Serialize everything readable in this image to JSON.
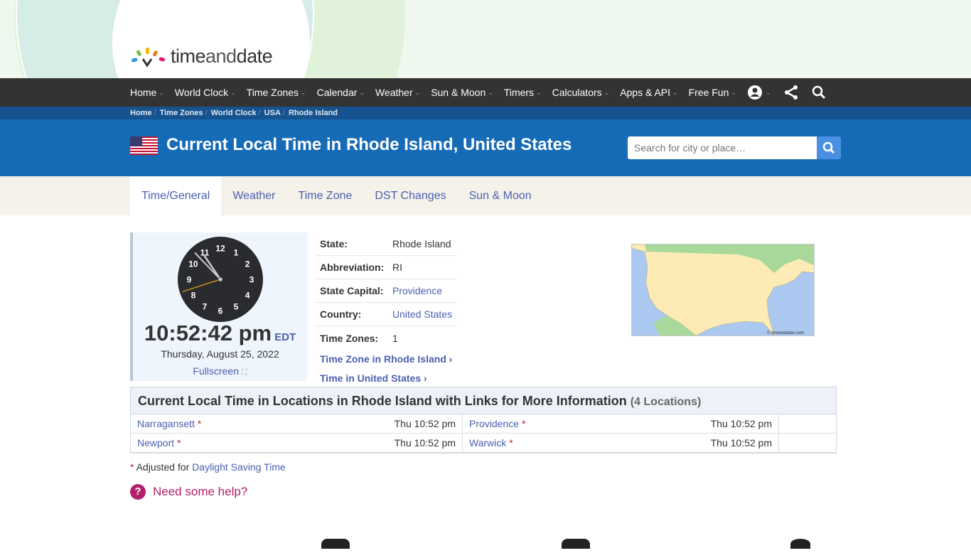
{
  "logo": {
    "text": "timeanddate"
  },
  "nav": {
    "items": [
      {
        "label": "Home"
      },
      {
        "label": "World Clock"
      },
      {
        "label": "Time Zones"
      },
      {
        "label": "Calendar"
      },
      {
        "label": "Weather"
      },
      {
        "label": "Sun & Moon"
      },
      {
        "label": "Timers"
      },
      {
        "label": "Calculators"
      },
      {
        "label": "Apps & API"
      },
      {
        "label": "Free Fun"
      }
    ],
    "icons": [
      "user-icon",
      "share-icon",
      "search-icon"
    ]
  },
  "breadcrumb": [
    "Home",
    "Time Zones",
    "World Clock",
    "USA",
    "Rhode Island"
  ],
  "header": {
    "title": "Current Local Time in Rhode Island, United States",
    "search_placeholder": "Search for city or place…"
  },
  "tabs": [
    {
      "label": "Time/General",
      "active": true
    },
    {
      "label": "Weather"
    },
    {
      "label": "Time Zone"
    },
    {
      "label": "DST Changes"
    },
    {
      "label": "Sun & Moon"
    }
  ],
  "clock": {
    "time": "10:52:42 pm",
    "tz": "EDT",
    "date": "Thursday, August 25, 2022",
    "fullscreen": "Fullscreen",
    "numbers": [
      "12",
      "1",
      "2",
      "3",
      "4",
      "5",
      "6",
      "7",
      "8",
      "9",
      "10",
      "11"
    ]
  },
  "info": {
    "rows": [
      {
        "k": "State:",
        "v": "Rhode Island"
      },
      {
        "k": "Abbreviation:",
        "v": "RI"
      },
      {
        "k": "State Capital:",
        "v": "Providence",
        "link": true
      },
      {
        "k": "Country:",
        "v": "United States",
        "link": true
      },
      {
        "k": "Time Zones:",
        "v": "1"
      }
    ],
    "links": [
      "Time Zone in Rhode Island",
      "Time in United States"
    ]
  },
  "map": {
    "credit": "© timeanddate.com"
  },
  "locations": {
    "title": "Current Local Time in Locations in Rhode Island with Links for More Information",
    "count": "(4 Locations)",
    "rows": [
      [
        {
          "name": "Narragansett",
          "time": "Thu 10:52 pm"
        },
        {
          "name": "Providence",
          "time": "Thu 10:52 pm"
        }
      ],
      [
        {
          "name": "Newport",
          "time": "Thu 10:52 pm"
        },
        {
          "name": "Warwick",
          "time": "Thu 10:52 pm"
        }
      ]
    ]
  },
  "note": {
    "star": "*",
    "text": "Adjusted for",
    "link": "Daylight Saving Time"
  },
  "help": {
    "label": "Need some help?"
  },
  "colors": {
    "nav": "#333333",
    "breadcrumb": "#15528e",
    "header": "#166bb6",
    "link": "#4a5fb0",
    "help": "#b21f6a"
  }
}
